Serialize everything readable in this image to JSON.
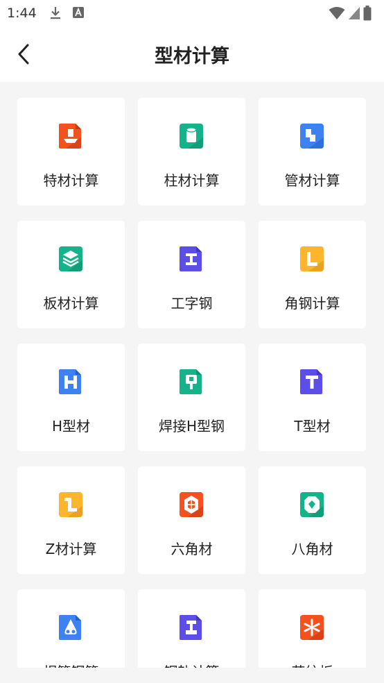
{
  "status_bar": {
    "time": "1:44"
  },
  "header": {
    "title": "型材计算"
  },
  "items": [
    {
      "label": "特材计算",
      "icon": "special-material-icon",
      "color": "#F4511E"
    },
    {
      "label": "柱材计算",
      "icon": "cylinder-icon",
      "color": "#14B38A"
    },
    {
      "label": "管材计算",
      "icon": "pipe-icon",
      "color": "#3D82F0"
    },
    {
      "label": "板材计算",
      "icon": "layers-icon",
      "color": "#14B38A"
    },
    {
      "label": "工字钢",
      "icon": "i-beam-icon",
      "color": "#5C4EE8"
    },
    {
      "label": "角钢计算",
      "icon": "angle-steel-icon",
      "color": "#FDB52E"
    },
    {
      "label": "H型材",
      "icon": "h-beam-icon",
      "color": "#3D82F0"
    },
    {
      "label": "焊接H型钢",
      "icon": "welded-h-beam-icon",
      "color": "#14B38A"
    },
    {
      "label": "T型材",
      "icon": "t-beam-icon",
      "color": "#5C4EE8"
    },
    {
      "label": "Z材计算",
      "icon": "z-profile-icon",
      "color": "#FDB52E"
    },
    {
      "label": "六角材",
      "icon": "hexagon-icon",
      "color": "#F4511E"
    },
    {
      "label": "八角材",
      "icon": "octagon-icon",
      "color": "#14B38A"
    },
    {
      "label": "焊管钢管",
      "icon": "welded-pipe-icon",
      "color": "#3D82F0"
    },
    {
      "label": "钢轨计算",
      "icon": "rail-icon",
      "color": "#5C4EE8"
    },
    {
      "label": "花纹板",
      "icon": "pattern-plate-icon",
      "color": "#F4511E"
    }
  ]
}
